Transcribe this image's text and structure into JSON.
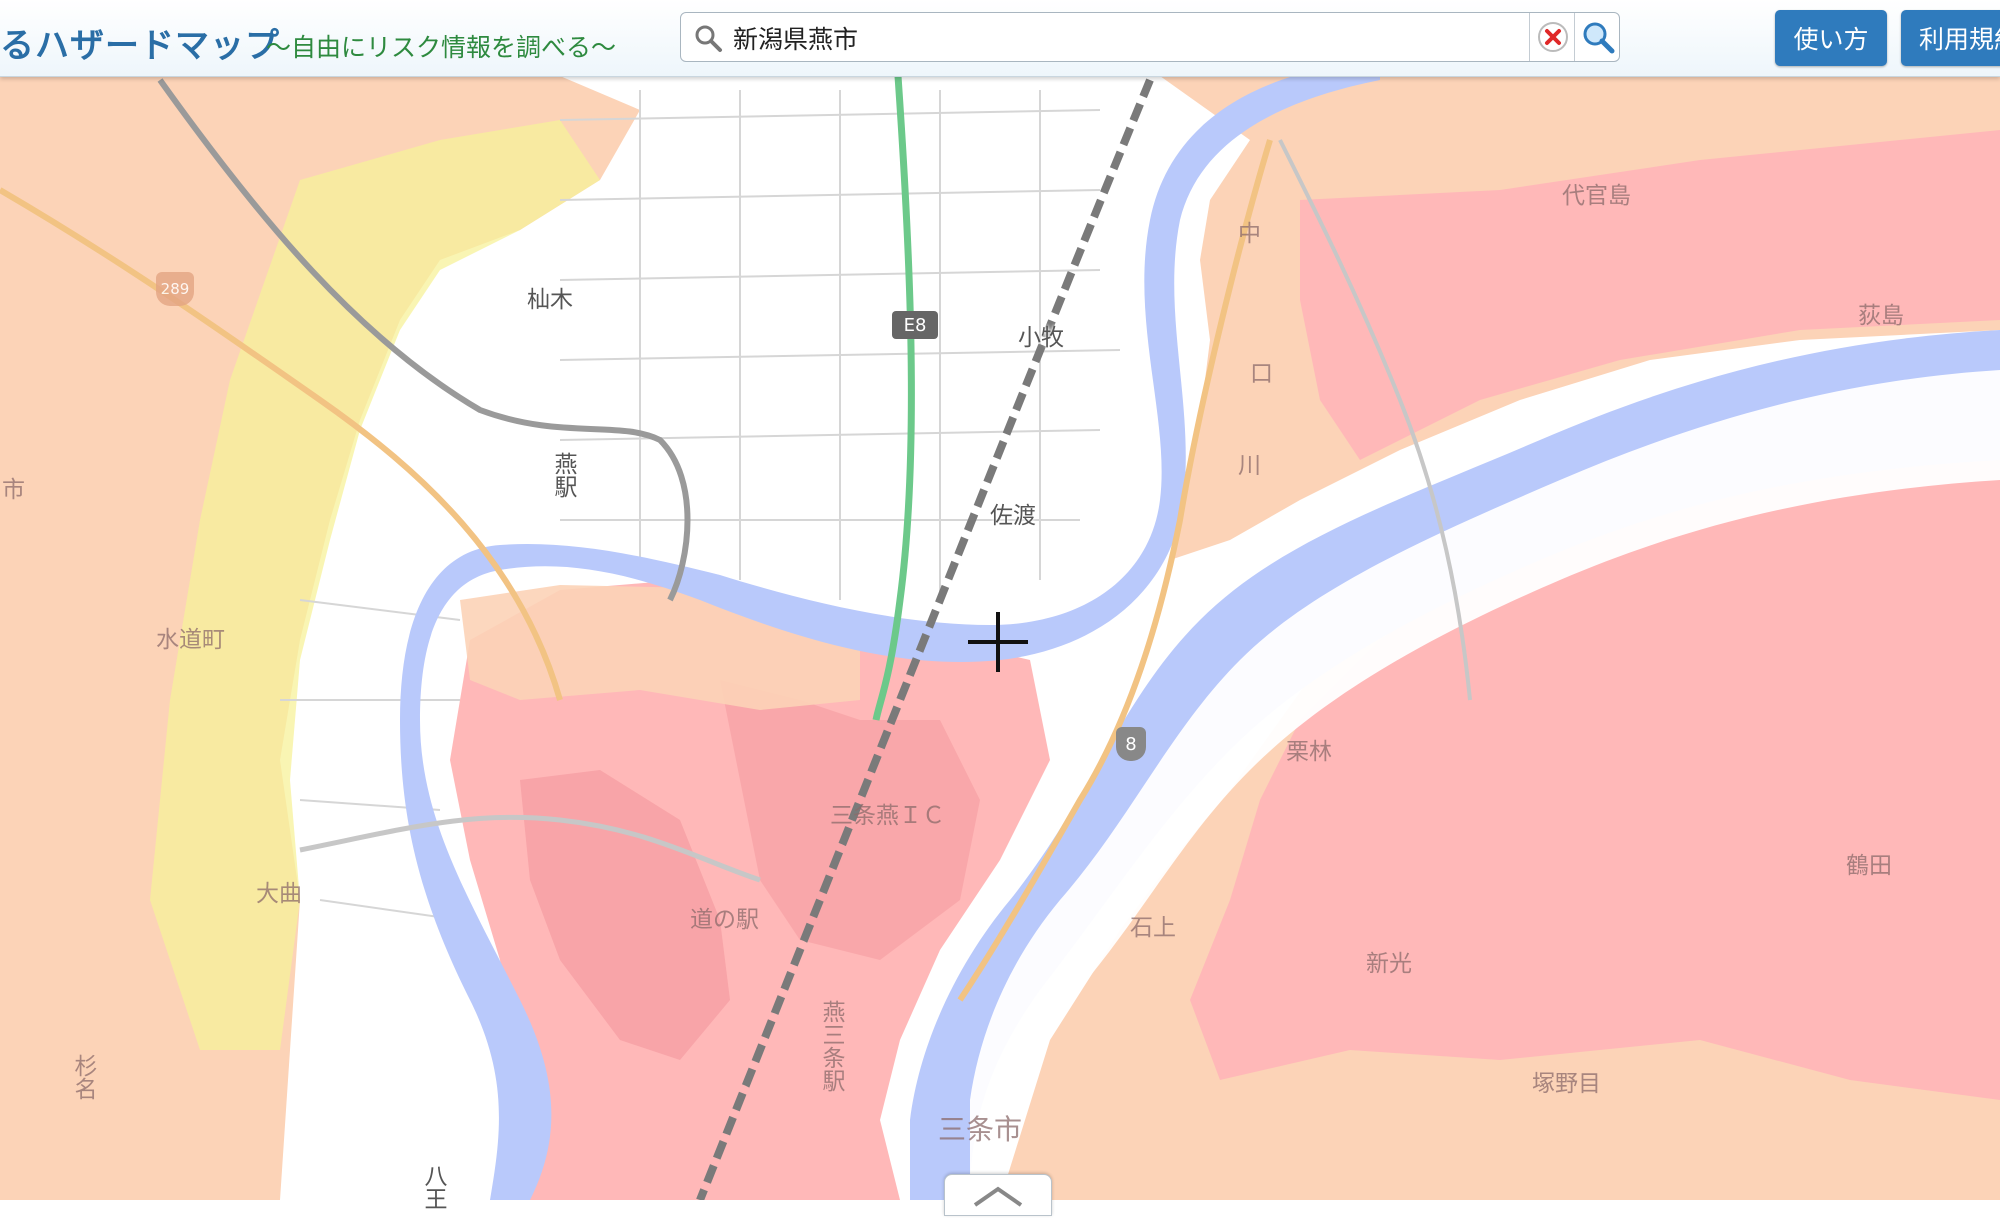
{
  "header": {
    "title": "るハザードマップ",
    "subtitle": "～自由にリスク情報を調べる～",
    "search": {
      "value": "新潟県燕市",
      "placeholder": ""
    },
    "buttons": {
      "help": "使い方",
      "terms": "利用規約"
    }
  },
  "map": {
    "place_labels": {
      "yuzuki": "杣木",
      "komaki": "小牧",
      "sado": "佐渡",
      "tsubame_station": "燕駅",
      "suidocho": "水道町",
      "daikyoku": "大曲",
      "sugina": "杉名",
      "hachi": "八王",
      "michinoeki": "道の駅",
      "tsubamesanjo_ic": "三条燕ＩＣ",
      "tsubamesanjo_station": "燕三条駅",
      "sanjo_city": "三条市",
      "daikanjima": "代官島",
      "ogijima": "荻島",
      "kuribayashi": "栗林",
      "tsuruda": "鶴田",
      "ishigami": "石上",
      "shinko": "新光",
      "tsukanome": "塚野目",
      "naka": "中",
      "ichi": "市",
      "kuchi": "口",
      "kawa": "川"
    },
    "road_shields": {
      "expressway": "E8",
      "route8": "8",
      "route289": "289"
    },
    "colors": {
      "base": "#ffffff",
      "river": "#b9c9fb",
      "flood_light": "#fcd3b7",
      "flood_medium": "#ffb8b8",
      "flood_deep": "#f7a0a4",
      "yellow": "#f7f19a",
      "expressway": "#6cc98a"
    }
  }
}
